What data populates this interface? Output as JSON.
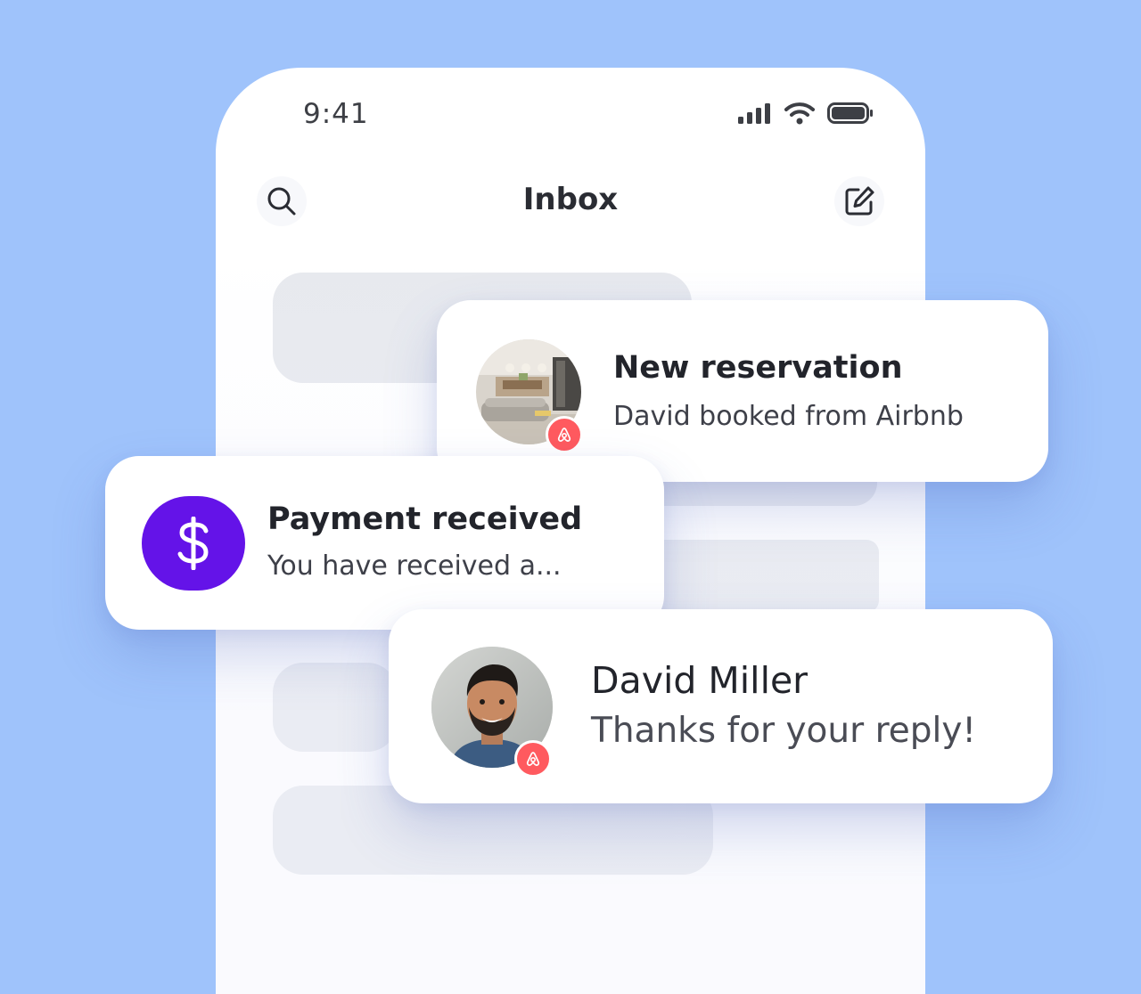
{
  "status_bar": {
    "time": "9:41"
  },
  "header": {
    "title": "Inbox",
    "search_icon": "search-icon",
    "compose_icon": "compose-icon"
  },
  "notifications": [
    {
      "title": "New reservation",
      "subtitle": "David booked from Airbnb",
      "avatar": "room-photo",
      "badge_icon": "airbnb-icon"
    },
    {
      "title": "Payment received",
      "subtitle": "You have received a...",
      "avatar_icon": "dollar-icon",
      "accent": "#6413e8"
    },
    {
      "title": "David Miller",
      "subtitle": "Thanks for your reply!",
      "avatar": "person-photo",
      "badge_icon": "airbnb-icon"
    }
  ],
  "colors": {
    "background": "#9fc3fb",
    "airbnb": "#ff5a5f",
    "payment_accent": "#6413e8"
  }
}
